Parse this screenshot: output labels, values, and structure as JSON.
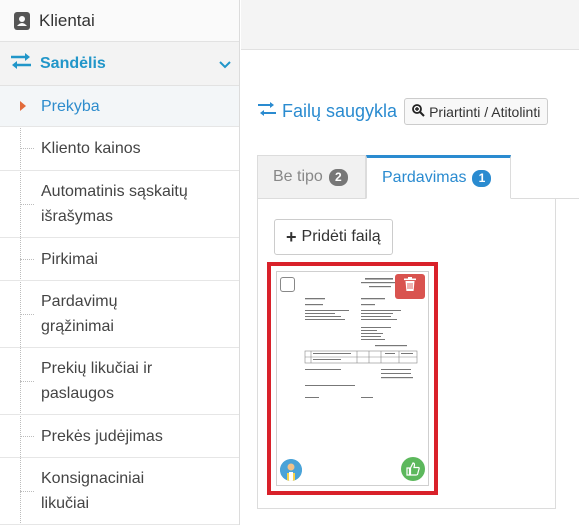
{
  "sidebar": {
    "top_item": {
      "label": "Klientai",
      "icon": "contacts-book-icon"
    },
    "section": {
      "label": "Sandėlis",
      "icon": "exchange-arrows-icon",
      "color": "#2196c9"
    },
    "items": [
      {
        "label": "Prekyba",
        "active": true
      },
      {
        "label": "Kliento kainos"
      },
      {
        "label": "Automatinis sąskaitų išrašymas"
      },
      {
        "label": "Pirkimai"
      },
      {
        "label": "Pardavimų grąžinimai"
      },
      {
        "label": "Prekių likučiai ir paslaugos"
      },
      {
        "label": "Prekės judėjimas"
      },
      {
        "label": "Konsignaciniai likučiai"
      }
    ]
  },
  "main": {
    "files_title": "Failų saugykla",
    "zoom_button": "Priartinti / Atitolinti",
    "tabs": [
      {
        "label": "Be tipo",
        "count": "2",
        "active": false
      },
      {
        "label": "Pardavimas",
        "count": "1",
        "active": true
      }
    ],
    "add_file_button": "Pridėti failą",
    "thumbnail": {
      "icons": {
        "delete": "trash-icon",
        "user": "avatar-icon",
        "approve": "thumbs-up-icon"
      },
      "highlight_color": "#d9212a"
    }
  },
  "colors": {
    "accent": "#2a8bd0",
    "caret": "#e26b3c",
    "danger": "#d9534f",
    "success": "#5cb85c"
  }
}
